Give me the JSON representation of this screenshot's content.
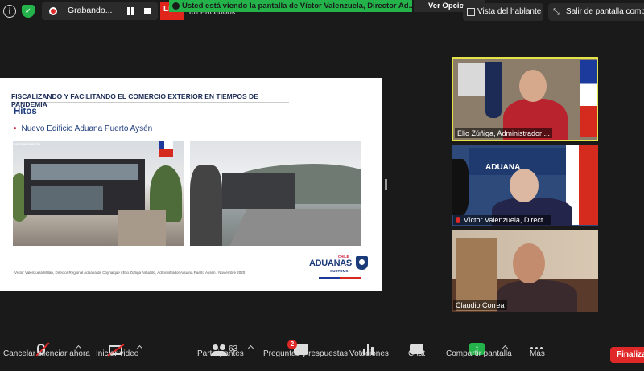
{
  "topbar": {
    "recording_label": "Grabando...",
    "live_badge": "LIVE",
    "facebook_label": "en Facebook",
    "notice": "Usted está viendo la pantalla de Víctor Valenzuela, Director Ad...",
    "view_options": "Ver Opciones",
    "speaker_view": "Vista del hablante",
    "exit_fullscreen": "Salir de pantalla completa"
  },
  "slide": {
    "header": "FISCALIZANDO Y FACILITANDO EL COMERCIO EXTERIOR EN TIEMPOS DE PANDEMIA",
    "title": "Hitos",
    "bullet": "Nuevo Edificio Aduana Puerto Aysén",
    "render_tag": "ANTEPROYECTO",
    "footer": "Víctor Valenzuela Millán, Director Regional Aduana de Coyhaique / Elio Zúñiga Astudillo, Administrador Aduana Puerto Aysén / Noviembre 2020",
    "logo": {
      "chile": "CHILE",
      "main": "ADUANAS",
      "customs": "CUSTOMS"
    }
  },
  "participants": [
    {
      "name": "Elio Zúñiga, Administrador ...",
      "muted": false
    },
    {
      "name": "Víctor Valenzuela, Direct...",
      "muted": true,
      "banner": "ADUANA"
    },
    {
      "name": "Claudio Correa",
      "muted": false
    }
  ],
  "toolbar": {
    "mute": "Cancelar silenciar ahora",
    "video": "Iniciar video",
    "participants": "Participantes",
    "participants_count": "63",
    "qa": "Preguntas y respuestas",
    "qa_badge": "2",
    "polls": "Votaciones",
    "chat": "Chat",
    "share": "Compartir pantalla",
    "more": "Más",
    "end": "Finalizar"
  },
  "colors": {
    "accent_green": "#23b34a",
    "live_red": "#e0251d",
    "active_speaker": "#e4e44a",
    "brand_blue": "#1b3a7a"
  }
}
